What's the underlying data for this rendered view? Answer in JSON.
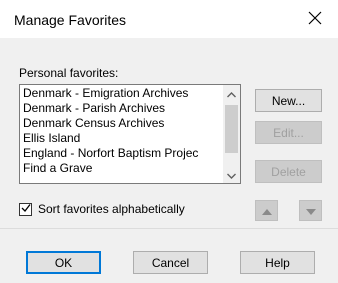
{
  "window": {
    "title": "Manage Favorites",
    "close_icon": "close-icon"
  },
  "favorites": {
    "label": "Personal favorites:",
    "items": [
      "Denmark - Emigration Archives",
      "Denmark - Parish Archives",
      "Denmark Census Archives",
      "Ellis Island",
      "England - Norfort Baptism Projec",
      "Find a Grave"
    ]
  },
  "buttons": {
    "new": "New...",
    "edit": "Edit...",
    "delete": "Delete",
    "ok": "OK",
    "cancel": "Cancel",
    "help": "Help"
  },
  "sort": {
    "label": "Sort favorites alphabetically",
    "checked": true
  },
  "colors": {
    "accent": "#0078d7",
    "dialog_bg": "#f0f0f0",
    "disabled_text": "#a0a0a0"
  }
}
